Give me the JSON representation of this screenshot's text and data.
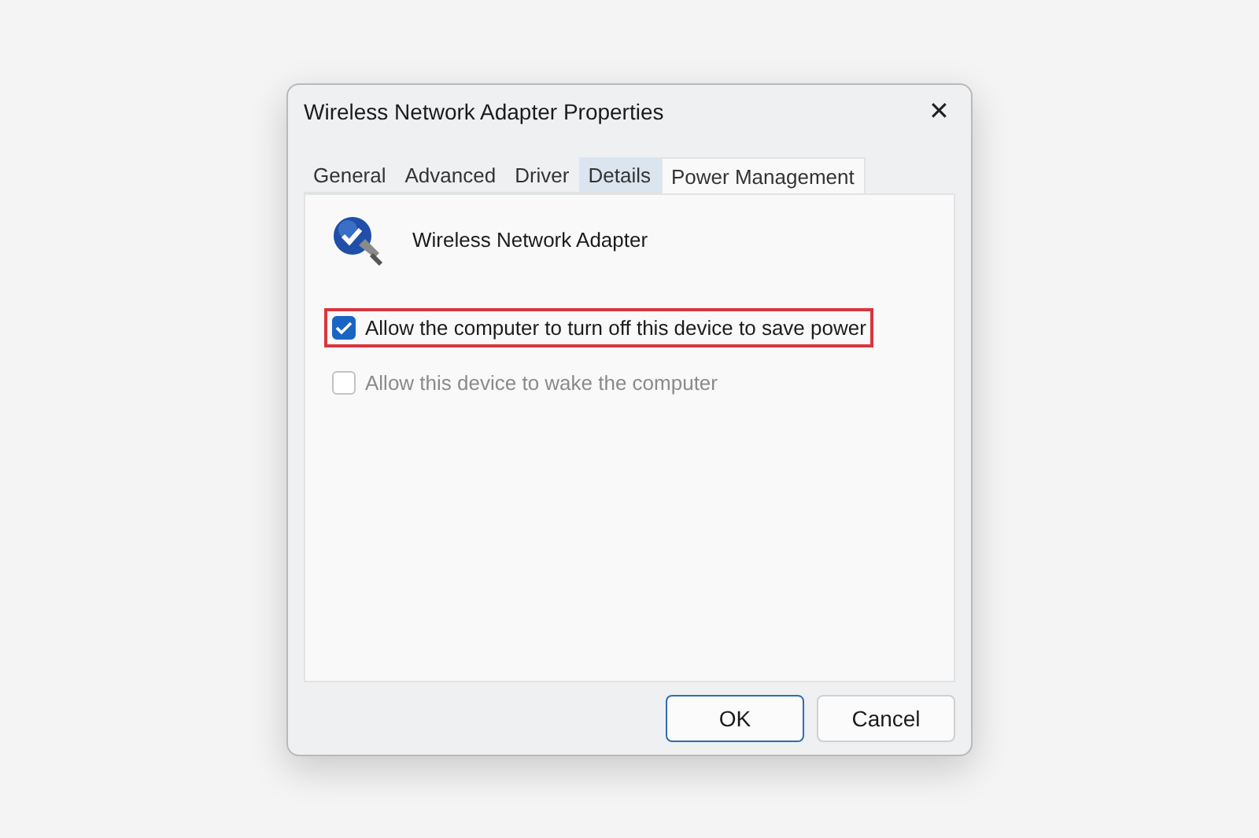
{
  "window": {
    "title": "Wireless Network Adapter Properties",
    "close": "✕"
  },
  "tabs": [
    {
      "label": "General",
      "selected": false,
      "hovered": false
    },
    {
      "label": "Advanced",
      "selected": false,
      "hovered": false
    },
    {
      "label": "Driver",
      "selected": false,
      "hovered": false
    },
    {
      "label": "Details",
      "selected": false,
      "hovered": true
    },
    {
      "label": "Power Management",
      "selected": true,
      "hovered": false
    }
  ],
  "device": {
    "name": "Wireless Network Adapter"
  },
  "options": [
    {
      "label": "Allow the computer to turn off this device to save power",
      "checked": true,
      "disabled": false,
      "highlighted": true
    },
    {
      "label": "Allow this device to wake the computer",
      "checked": false,
      "disabled": true,
      "highlighted": false
    }
  ],
  "buttons": [
    {
      "label": "OK",
      "default": true
    },
    {
      "label": "Cancel",
      "default": false
    }
  ]
}
